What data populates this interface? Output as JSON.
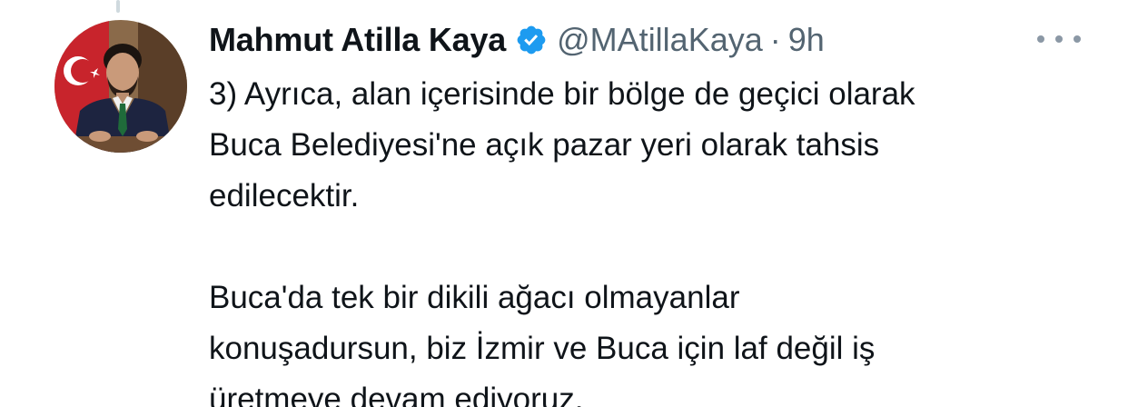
{
  "tweet": {
    "author": {
      "display_name": "Mahmut Atilla Kaya",
      "handle": "@MAtillaKaya",
      "verified": true,
      "verified_color": "#1d9bf0",
      "avatar_icon": "profile-photo"
    },
    "separator": "·",
    "timestamp": "9h",
    "more_icon": "more-horizontal-icon",
    "paragraphs": [
      "3) Ayrıca, alan içerisinde bir bölge de geçici olarak\nBuca Belediyesi'ne açık pazar yeri olarak tahsis\nedilecektir.",
      "Buca'da tek bir dikili ağacı olmayanlar\nkonuşadursun, biz İzmir ve Buca için laf değil iş\nüretmeye devam ediyoruz."
    ]
  },
  "colors": {
    "text_primary": "#0f1419",
    "text_secondary": "#536471",
    "thread_line": "#cfd9de"
  }
}
